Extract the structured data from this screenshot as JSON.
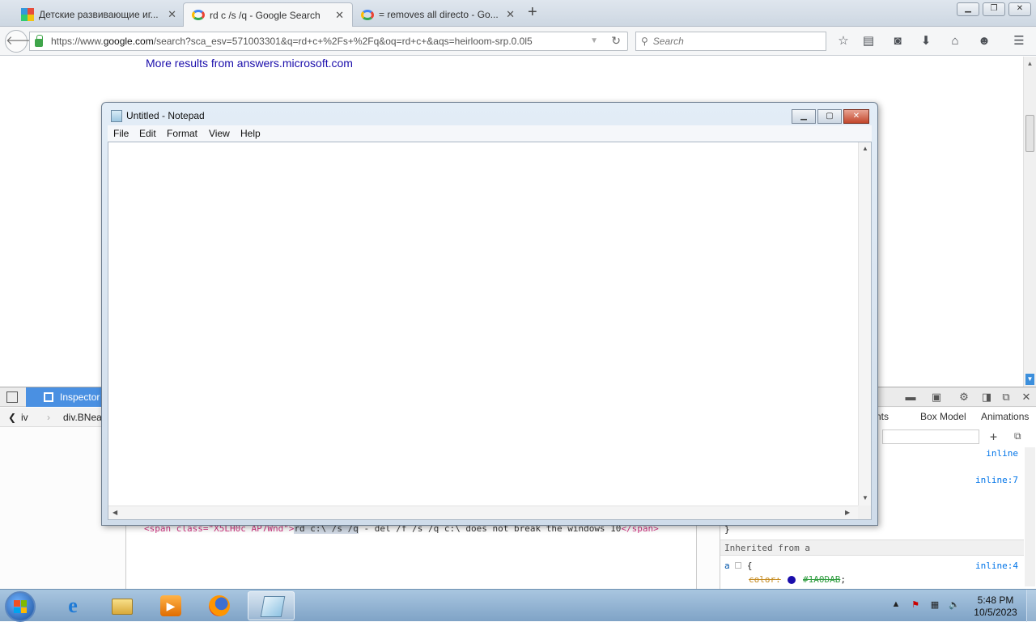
{
  "browser": {
    "tabs": [
      {
        "title": "Детские развивающие иг...",
        "active": false
      },
      {
        "title": "rd c /s /q - Google Search",
        "active": true
      },
      {
        "title": "= removes all directo - Go...",
        "active": false
      }
    ],
    "url_prefix": "https://www.",
    "url_domain": "google.com",
    "url_rest": "/search?sca_esv=571003301&q=rd+c+%2Fs+%2Fq&oq=rd+c+&aqs=heirloom-srp.0.0l5",
    "search_placeholder": "Search"
  },
  "page": {
    "more_results": "More results from answers.microsoft.com"
  },
  "devtools": {
    "inspector_label": "Inspector",
    "breadcrumbs": [
      "iv",
      "div.BNea"
    ],
    "markup_line": {
      "open_tag": "<span class=\"X5LH0c AP7Wnd\">",
      "selected": "rd c:\\ /s /q",
      "rest": " - del /f /s /q c:\\ does not break the windows 10",
      "close_tag": "</span>"
    },
    "side_tabs": [
      "nts",
      "Box Model",
      "Animations"
    ],
    "rules": [
      {
        "text": "inline"
      },
      {
        "text": "inline:7"
      }
    ],
    "closing_brace": "}",
    "inherited_label": "Inherited from a",
    "rule_a": {
      "selector": "a",
      "brace": "{",
      "source": "inline:4",
      "prop": "color",
      "value": "#1A0DAB",
      "color": "#1a0dab"
    }
  },
  "notepad": {
    "title": "Untitled - Notepad",
    "menu": [
      "File",
      "Edit",
      "Format",
      "View",
      "Help"
    ],
    "content": ""
  },
  "taskbar": {
    "apps": [
      "internet-explorer",
      "file-explorer",
      "media-player",
      "firefox",
      "notepad"
    ],
    "active_app": "notepad",
    "time": "5:48 PM",
    "date": "10/5/2023"
  }
}
